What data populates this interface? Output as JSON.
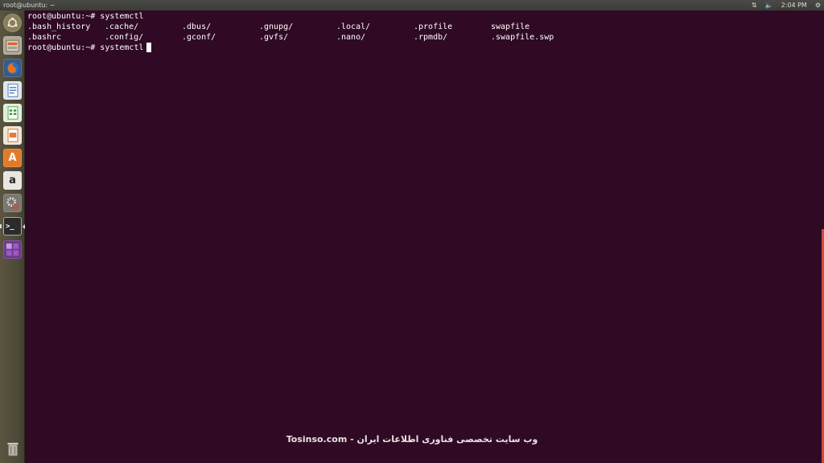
{
  "top_panel": {
    "window_title": "root@ubuntu: ~",
    "time": "2:04 PM",
    "network_icon": "updown-arrows-icon",
    "volume_icon": "speaker-icon",
    "settings_icon": "gear-icon"
  },
  "launcher": {
    "items": [
      {
        "name": "dash-home",
        "icon": "ubuntu-logo-icon"
      },
      {
        "name": "files",
        "icon": "file-cabinet-icon"
      },
      {
        "name": "firefox",
        "icon": "firefox-icon"
      },
      {
        "name": "writer",
        "icon": "libreoffice-writer-icon"
      },
      {
        "name": "calc",
        "icon": "libreoffice-calc-icon"
      },
      {
        "name": "impress",
        "icon": "libreoffice-impress-icon"
      },
      {
        "name": "software-center",
        "icon": "software-center-icon",
        "glyph": "A"
      },
      {
        "name": "amazon",
        "icon": "amazon-icon",
        "glyph": "a"
      },
      {
        "name": "system-settings",
        "icon": "settings-gears-icon"
      },
      {
        "name": "terminal",
        "icon": "terminal-icon",
        "glyph": ">_"
      },
      {
        "name": "workspaces",
        "icon": "workspace-switcher-icon"
      },
      {
        "name": "trash",
        "icon": "trash-icon"
      }
    ]
  },
  "terminal": {
    "line1": "root@ubuntu:~# systemctl",
    "ls_row1": [
      ".bash_history",
      ".cache/",
      ".dbus/",
      ".gnupg/",
      ".local/",
      ".profile",
      "swapfile"
    ],
    "ls_row2": [
      ".bashrc",
      ".config/",
      ".gconf/",
      ".gvfs/",
      ".nano/",
      ".rpmdb/",
      ".swapfile.swp"
    ],
    "prompt": "root@ubuntu:~# systemctl"
  },
  "colors": {
    "terminal_bg": "#300a24",
    "terminal_fg": "#ffffff",
    "panel_bg": "#3c3b37",
    "launcher_bg": "#524d3d"
  },
  "watermark": "Tosinso.com - وب سایت تخصصی فناوری اطلاعات ایران"
}
